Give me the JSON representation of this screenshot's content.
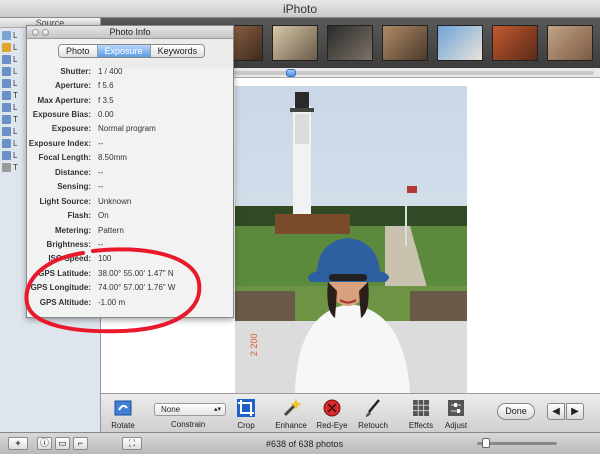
{
  "window": {
    "title": "iPhoto"
  },
  "source": {
    "header": "Source",
    "items": [
      {
        "label": "L",
        "icon": "library-icon",
        "color": "#7aa3d6"
      },
      {
        "label": "L",
        "icon": "film-roll-icon",
        "color": "#e0a531"
      },
      {
        "label": "L",
        "icon": "folder-icon",
        "color": "#6b92c8"
      },
      {
        "label": "L",
        "icon": "folder-icon",
        "color": "#6b92c8"
      },
      {
        "label": "L",
        "icon": "folder-icon",
        "color": "#6b92c8"
      },
      {
        "label": "T",
        "icon": "folder-icon",
        "color": "#6b92c8"
      },
      {
        "label": "L",
        "icon": "folder-icon",
        "color": "#6b92c8"
      },
      {
        "label": "T",
        "icon": "album-icon",
        "color": "#6b92c8"
      },
      {
        "label": "L",
        "icon": "book-icon",
        "color": "#6b92c8"
      },
      {
        "label": "L",
        "icon": "calendar-icon",
        "color": "#6b92c8"
      },
      {
        "label": "L",
        "icon": "card-icon",
        "color": "#6b92c8"
      },
      {
        "label": "T",
        "icon": "trash-icon",
        "color": "#9a9a9a"
      }
    ]
  },
  "photo_info": {
    "title": "Photo Info",
    "tabs": [
      "Photo",
      "Exposure",
      "Keywords"
    ],
    "active_tab": "Exposure",
    "rows": [
      {
        "label": "Shutter:",
        "value": "1 / 400"
      },
      {
        "label": "Aperture:",
        "value": "f 5.6"
      },
      {
        "label": "Max Aperture:",
        "value": "f 3.5"
      },
      {
        "label": "Exposure Bias:",
        "value": "0.00"
      },
      {
        "label": "Exposure:",
        "value": "Normal program"
      },
      {
        "label": "Exposure Index:",
        "value": "--"
      },
      {
        "label": "Focal Length:",
        "value": "8.50mm"
      },
      {
        "label": "Distance:",
        "value": "--"
      },
      {
        "label": "Sensing:",
        "value": "--"
      },
      {
        "label": "Light Source:",
        "value": "Unknown"
      },
      {
        "label": "Flash:",
        "value": "On"
      },
      {
        "label": "Metering:",
        "value": "Pattern"
      },
      {
        "label": "Brightness:",
        "value": "--"
      },
      {
        "label": "ISO Speed:",
        "value": "100"
      },
      {
        "label": "GPS Latitude:",
        "value": "38.00° 55.00' 1.47\" N"
      },
      {
        "label": "GPS Longitude:",
        "value": "74.00° 57.00' 1.76\" W"
      },
      {
        "label": "GPS Altitude:",
        "value": "-1.00 m"
      }
    ]
  },
  "toolbar": {
    "rotate": "Rotate",
    "constrain_value": "None",
    "constrain": "Constrain",
    "crop": "Crop",
    "enhance": "Enhance",
    "red_eye": "Red-Eye",
    "retouch": "Retouch",
    "effects": "Effects",
    "adjust": "Adjust",
    "done": "Done"
  },
  "status": {
    "count": "#638 of 638 photos",
    "add": "+"
  },
  "colors": {
    "annotation": "#e8192a",
    "accent": "#4a8be0"
  }
}
